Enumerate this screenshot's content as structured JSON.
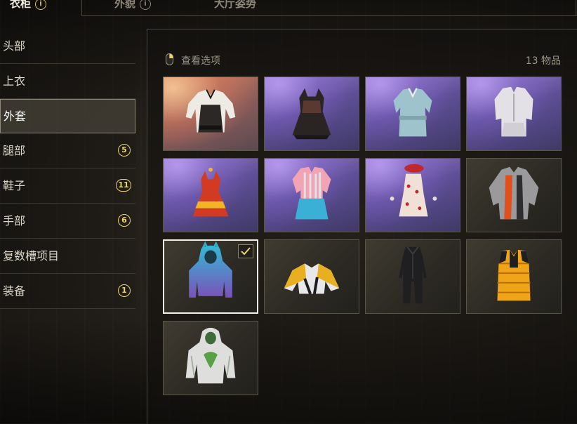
{
  "tabs": [
    {
      "label": "衣柜",
      "info": "i"
    },
    {
      "label": "外貌",
      "info": "i"
    },
    {
      "label": "大厅姿势"
    }
  ],
  "sidebar": {
    "items": [
      {
        "label": "头部"
      },
      {
        "label": "上衣"
      },
      {
        "label": "外套",
        "active": true
      },
      {
        "label": "腿部",
        "badge": "5"
      },
      {
        "label": "鞋子",
        "badge": "11"
      },
      {
        "label": "手部",
        "badge": "6"
      },
      {
        "label": "复数槽项目"
      },
      {
        "label": "装备",
        "badge": "1"
      }
    ]
  },
  "panel": {
    "view_options": "查看选项",
    "count": "13 物品"
  },
  "colors": {
    "accent": "#e9d46a",
    "selected_border": "#f4f1e8",
    "purple_bg": "#6a58a8",
    "orange_bg": "#c9806a"
  },
  "items": [
    {
      "icon": "black-white-jacket-icon",
      "rarity": "orange"
    },
    {
      "icon": "black-dress-icon",
      "rarity": "purple"
    },
    {
      "icon": "light-blue-uniform-icon",
      "rarity": "purple"
    },
    {
      "icon": "white-uniform-icon",
      "rarity": "purple"
    },
    {
      "icon": "red-dress-icon",
      "rarity": "purple"
    },
    {
      "icon": "pink-striped-dress-icon",
      "rarity": "purple"
    },
    {
      "icon": "polka-dot-dress-icon",
      "rarity": "purple"
    },
    {
      "icon": "grey-orange-jacket-icon",
      "rarity": "common"
    },
    {
      "icon": "blue-hoodie-icon",
      "rarity": "common",
      "selected": true
    },
    {
      "icon": "yellow-jacket-icon",
      "rarity": "common"
    },
    {
      "icon": "black-suit-icon",
      "rarity": "common"
    },
    {
      "icon": "orange-vest-icon",
      "rarity": "common"
    },
    {
      "icon": "white-green-hoodie-icon",
      "rarity": "common"
    }
  ]
}
